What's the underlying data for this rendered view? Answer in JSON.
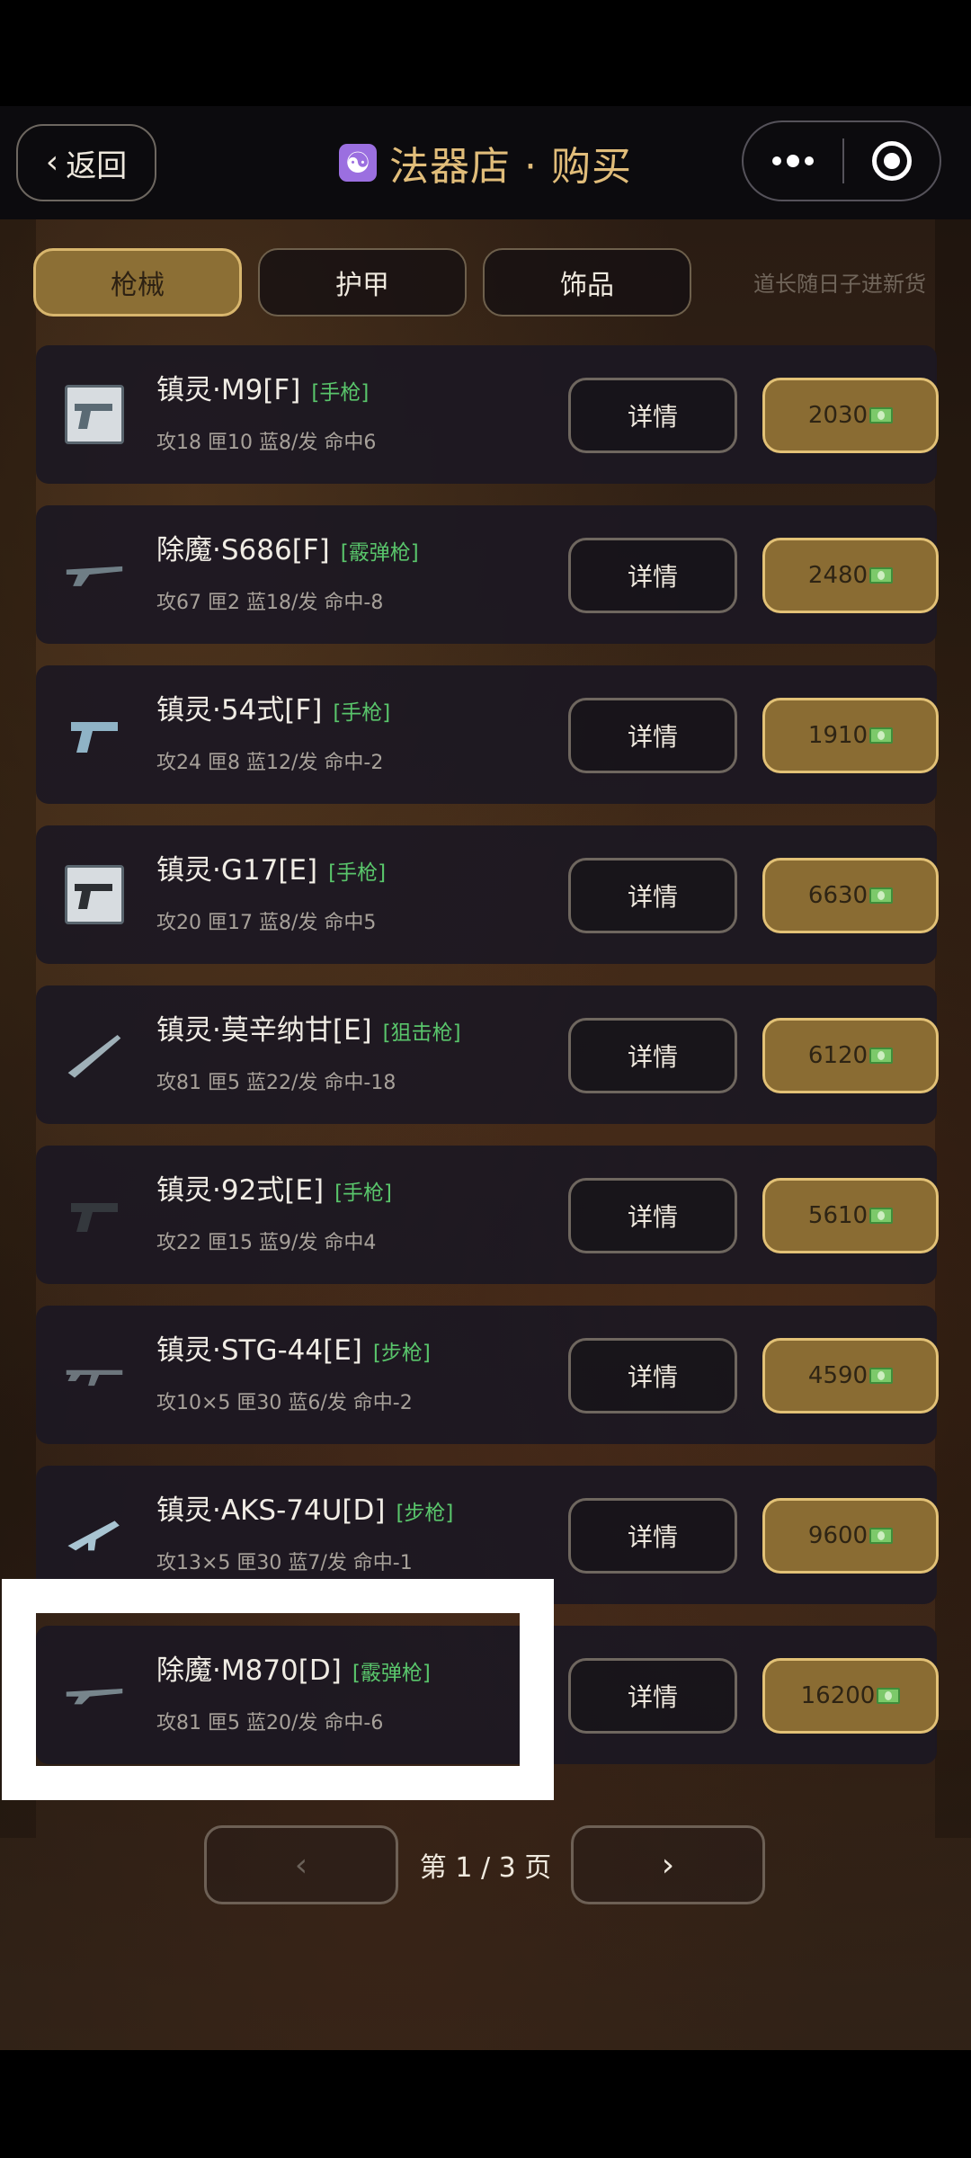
{
  "header": {
    "back_label": "返回",
    "title": "法器店 · 购买",
    "title_icon": "yin-yang-icon"
  },
  "tabs": [
    {
      "label": "枪械",
      "active": true
    },
    {
      "label": "护甲",
      "active": false
    },
    {
      "label": "饰品",
      "active": false
    }
  ],
  "notice": "道长随日子进新货",
  "detail_label": "详情",
  "items": [
    {
      "name": "镇灵·M9[F]",
      "type": "[手枪]",
      "stats": "攻18 匣10 蓝8/发 命中6",
      "price": "2030",
      "icon": "pistol-icon"
    },
    {
      "name": "除魔·S686[F]",
      "type": "[霰弹枪]",
      "stats": "攻67 匣2 蓝18/发 命中-8",
      "price": "2480",
      "icon": "shotgun-icon"
    },
    {
      "name": "镇灵·54式[F]",
      "type": "[手枪]",
      "stats": "攻24 匣8 蓝12/发 命中-2",
      "price": "1910",
      "icon": "pistol-icon"
    },
    {
      "name": "镇灵·G17[E]",
      "type": "[手枪]",
      "stats": "攻20 匣17 蓝8/发 命中5",
      "price": "6630",
      "icon": "pistol-icon"
    },
    {
      "name": "镇灵·莫辛纳甘[E]",
      "type": "[狙击枪]",
      "stats": "攻81 匣5 蓝22/发 命中-18",
      "price": "6120",
      "icon": "sniper-rifle-icon"
    },
    {
      "name": "镇灵·92式[E]",
      "type": "[手枪]",
      "stats": "攻22 匣15 蓝9/发 命中4",
      "price": "5610",
      "icon": "pistol-icon"
    },
    {
      "name": "镇灵·STG-44[E]",
      "type": "[步枪]",
      "stats": "攻10×5 匣30 蓝6/发 命中-2",
      "price": "4590",
      "icon": "rifle-icon"
    },
    {
      "name": "镇灵·AKS-74U[D]",
      "type": "[步枪]",
      "stats": "攻13×5 匣30 蓝7/发 命中-1",
      "price": "9600",
      "icon": "rifle-icon"
    },
    {
      "name": "除魔·M870[D]",
      "type": "[霰弹枪]",
      "stats": "攻81 匣5 蓝20/发 命中-6",
      "price": "16200",
      "icon": "shotgun-icon"
    }
  ],
  "pagination": {
    "label": "第 1 / 3 页",
    "prev": "‹",
    "next": "›"
  }
}
